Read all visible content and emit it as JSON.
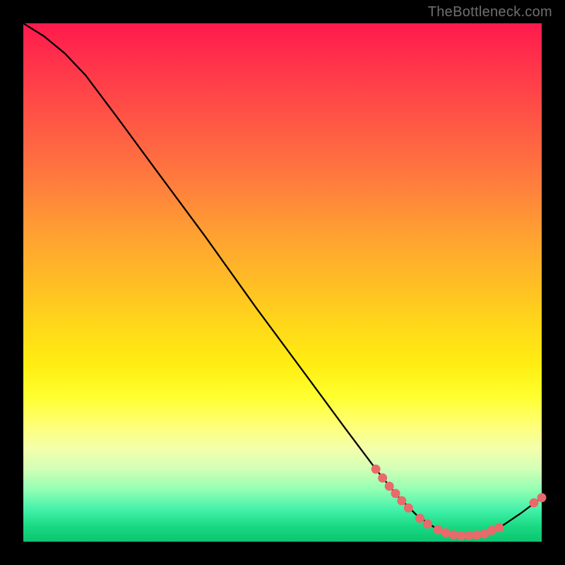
{
  "watermark": "TheBottleneck.com",
  "chart_data": {
    "type": "line",
    "title": "",
    "xlabel": "",
    "ylabel": "",
    "xlim": [
      0,
      100
    ],
    "ylim": [
      0,
      100
    ],
    "grid": false,
    "legend": false,
    "curve": [
      {
        "x": 0.0,
        "y": 100.0
      },
      {
        "x": 4.0,
        "y": 97.5
      },
      {
        "x": 8.0,
        "y": 94.2
      },
      {
        "x": 12.0,
        "y": 90.0
      },
      {
        "x": 18.0,
        "y": 82.0
      },
      {
        "x": 25.0,
        "y": 72.5
      },
      {
        "x": 35.0,
        "y": 59.0
      },
      {
        "x": 45.0,
        "y": 45.0
      },
      {
        "x": 55.0,
        "y": 31.5
      },
      {
        "x": 62.0,
        "y": 22.0
      },
      {
        "x": 68.0,
        "y": 14.0
      },
      {
        "x": 72.0,
        "y": 9.0
      },
      {
        "x": 76.0,
        "y": 5.0
      },
      {
        "x": 80.0,
        "y": 2.3
      },
      {
        "x": 84.0,
        "y": 1.2
      },
      {
        "x": 88.0,
        "y": 1.3
      },
      {
        "x": 92.0,
        "y": 2.8
      },
      {
        "x": 96.0,
        "y": 5.5
      },
      {
        "x": 100.0,
        "y": 8.5
      }
    ],
    "points": [
      {
        "x": 68.0,
        "y": 14.0
      },
      {
        "x": 69.3,
        "y": 12.3
      },
      {
        "x": 70.6,
        "y": 10.7
      },
      {
        "x": 71.8,
        "y": 9.3
      },
      {
        "x": 73.0,
        "y": 7.9
      },
      {
        "x": 74.3,
        "y": 6.5
      },
      {
        "x": 76.5,
        "y": 4.5
      },
      {
        "x": 78.0,
        "y": 3.4
      },
      {
        "x": 80.0,
        "y": 2.3
      },
      {
        "x": 81.5,
        "y": 1.7
      },
      {
        "x": 83.0,
        "y": 1.3
      },
      {
        "x": 84.5,
        "y": 1.15
      },
      {
        "x": 86.0,
        "y": 1.2
      },
      {
        "x": 87.5,
        "y": 1.3
      },
      {
        "x": 89.0,
        "y": 1.5
      },
      {
        "x": 90.4,
        "y": 2.2
      },
      {
        "x": 91.8,
        "y": 2.7
      },
      {
        "x": 98.5,
        "y": 7.5
      },
      {
        "x": 100.0,
        "y": 8.5
      }
    ]
  }
}
